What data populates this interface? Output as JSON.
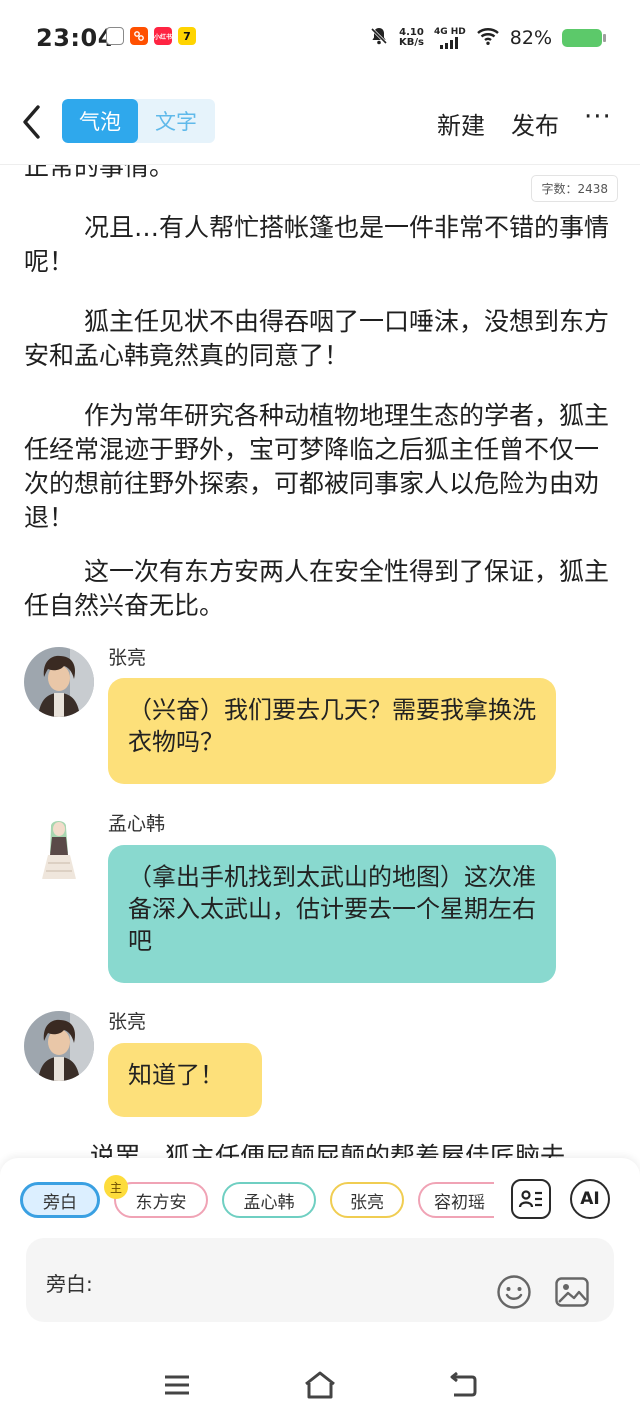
{
  "status_bar": {
    "time": "23:04",
    "app_icons": [
      {
        "name": "doc-app-icon",
        "color": "#9e9e9e",
        "label": ""
      },
      {
        "name": "taobao-app-icon",
        "color": "#ff5000",
        "label": ""
      },
      {
        "name": "xiaohongshu-app-icon",
        "color": "#ff2442",
        "label": "小红书"
      },
      {
        "name": "yellow-app-icon",
        "color": "#ffd400",
        "label": "7"
      }
    ],
    "net_speed": "4.10",
    "net_speed_unit": "KB/s",
    "network_type": "4G HD",
    "battery_percent": "82%",
    "battery_level": 0.82
  },
  "header": {
    "tabs": [
      {
        "label": "气泡",
        "active": true
      },
      {
        "label": "文字",
        "active": false
      }
    ],
    "new_label": "新建",
    "publish_label": "发布",
    "more_label": "···"
  },
  "content": {
    "partial_top_text": "正常的事情。",
    "word_count": "字数：2438",
    "paragraphs": [
      "况且…有人帮忙搭帐篷也是一件非常不错的事情呢！",
      "狐主任见状不由得吞咽了一口唾沫，没想到东方安和孟心韩竟然真的同意了！",
      "作为常年研究各种动植物地理生态的学者，狐主任经常混迹于野外，宝可梦降临之后狐主任曾不仅一次的想前往野外探索，可都被同事家人以危险为由劝退！",
      "这一次有东方安两人在安全性得到了保证，狐主任自然兴奋无比。"
    ],
    "messages": [
      {
        "name": "张亮",
        "text": "（兴奋）我们要去几天？需要我拿换洗衣物吗？",
        "color": "#fde07a"
      },
      {
        "name": "孟心韩",
        "text": "（拿出手机找到太武山的地图）这次准备深入太武山，估计要去一个星期左右吧",
        "color": "#89d9cf"
      },
      {
        "name": "张亮",
        "text": "知道了！",
        "color": "#fde07a"
      }
    ],
    "partial_bottom_text": "说罢，狐主任便屁颠屁颠的帮着屋佳匠脑去"
  },
  "bottom_panel": {
    "main_badge": "主",
    "chips": [
      {
        "label": "旁白",
        "selected": true
      },
      {
        "label": "东方安",
        "selected": false
      },
      {
        "label": "孟心韩",
        "selected": false
      },
      {
        "label": "张亮",
        "selected": false
      },
      {
        "label": "容初瑶",
        "selected": false
      }
    ],
    "ai_label": "AI",
    "input_label": "旁白:"
  }
}
